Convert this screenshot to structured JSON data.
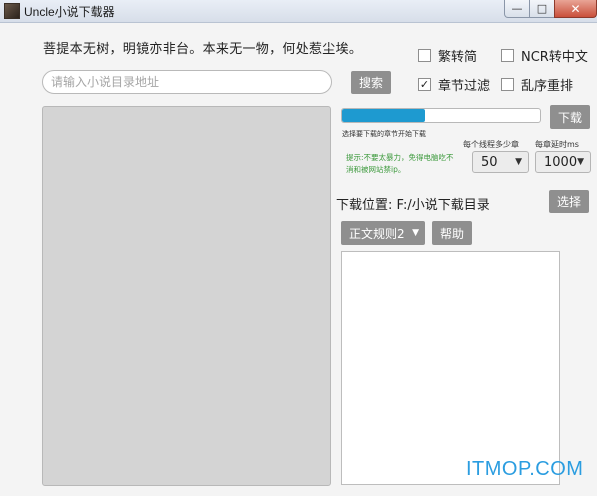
{
  "window": {
    "title": "Uncle小说下载器",
    "controls": {
      "minimize": "—",
      "maximize": "□",
      "close": "✕"
    }
  },
  "quote": "菩提本无树，明镜亦非台。本来无一物，何处惹尘埃。",
  "search": {
    "placeholder": "请输入小说目录地址",
    "button": "搜索"
  },
  "options": [
    {
      "label": "繁转简",
      "checked": false
    },
    {
      "label": "NCR转中文",
      "checked": false
    },
    {
      "label": "章节过滤",
      "checked": true
    },
    {
      "label": "乱序重排",
      "checked": false
    }
  ],
  "download": {
    "button": "下载",
    "progress": 0.42,
    "status": "选择要下载的章节开始下载",
    "tip": "提示:不要太暴力，免得电脑吃不消和被网站禁ip。",
    "threads_label": "每个线程多少章",
    "threads_value": "50",
    "delay_label": "每章延时ms",
    "delay_value": "1000",
    "location": "下载位置: F:/小说下载目录",
    "choose_button": "选择"
  },
  "rules": {
    "selected": "正文规则2",
    "help_button": "帮助"
  },
  "watermark": "ITMOP.COM",
  "colors": {
    "accent": "#1e9ad0",
    "button": "#8f8f8f",
    "tip": "#3d9a3d",
    "watermark": "#2b9de0"
  }
}
